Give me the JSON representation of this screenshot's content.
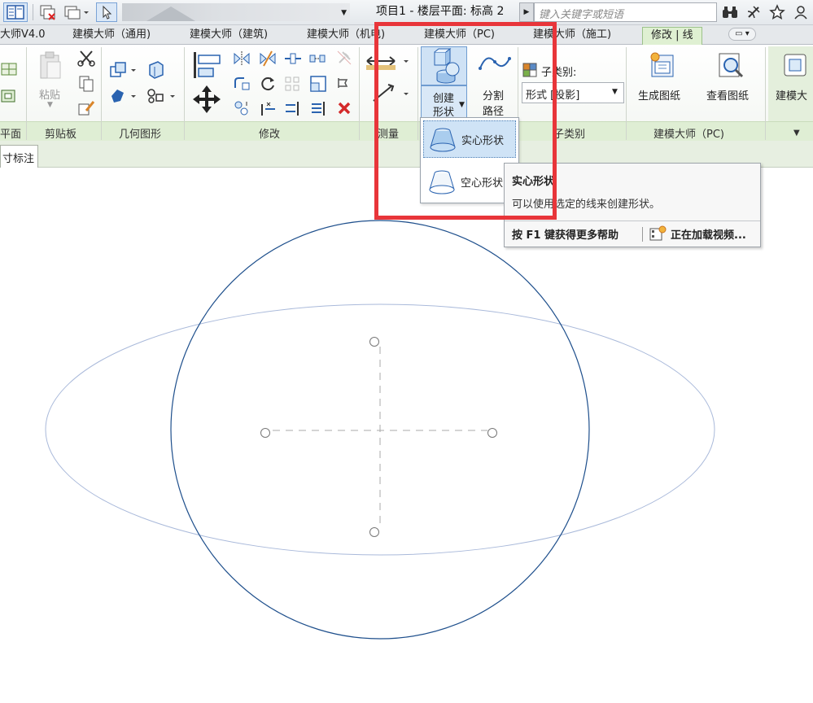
{
  "window": {
    "title": "项目1 - 楼层平面: 标高 2"
  },
  "search": {
    "placeholder": "键入关键字或短语"
  },
  "tabs": [
    {
      "label": "大师V4.0"
    },
    {
      "label": "建模大师（通用)"
    },
    {
      "label": "建模大师（建筑)"
    },
    {
      "label": "建模大师（机电)"
    },
    {
      "label": "建模大师（PC)"
    },
    {
      "label": "建模大师（施工)"
    },
    {
      "label": "修改 | 线"
    }
  ],
  "ribbon": {
    "paste_label": "粘贴",
    "create_form_label_1": "创建",
    "create_form_label_2": "形状",
    "split_path_label_1": "分割",
    "split_path_label_2": "路径",
    "subcategory_label": "子类别:",
    "subcategory_value": "形式 [投影]",
    "generate_drawing_label": "生成图纸",
    "view_drawing_label": "查看图纸",
    "modeling_master_label": "建模大",
    "panels": {
      "plane": "平面",
      "clipboard": "剪贴板",
      "geometry": "几何图形",
      "modify": "修改",
      "measure": "测量",
      "subcategory": "子类别",
      "modeling_master_pc": "建模大师（PC)"
    }
  },
  "doc_tab": {
    "label": "寸标注"
  },
  "dropdown": {
    "items": [
      {
        "label": "实心形状"
      },
      {
        "label": "空心形状"
      }
    ]
  },
  "tooltip": {
    "title": "实心形状",
    "description": "可以使用选定的线来创建形状。",
    "help": "按 F1 键获得更多帮助",
    "video": "正在加载视频..."
  },
  "colors": {
    "highlight": "#e8353a",
    "circle": "#1e4f8c",
    "ellipse": "#a9b9da",
    "active_tab": "#dff0d2"
  }
}
